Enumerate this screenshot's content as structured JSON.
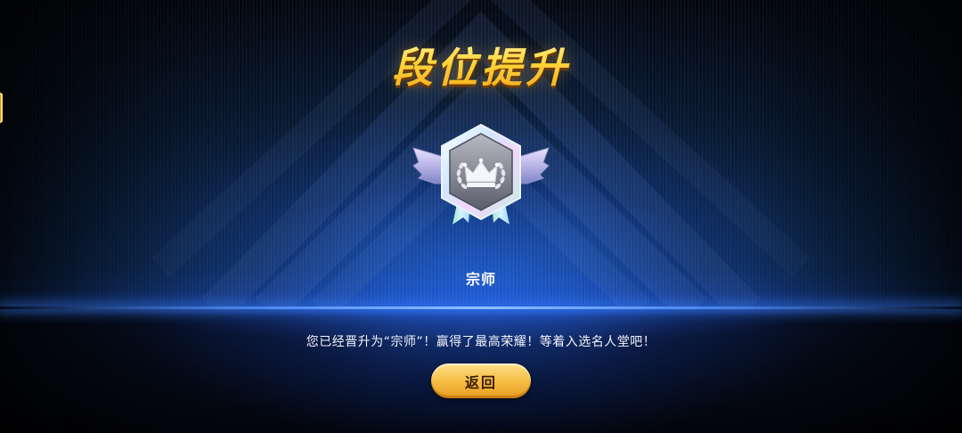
{
  "title": "段位提升",
  "rank": {
    "name": "宗师",
    "icon": "grandmaster-crown-badge-icon"
  },
  "message": "您已经晋升为“宗师”！赢得了最高荣耀！等着入选名人堂吧！",
  "back_button": {
    "label": "返回"
  },
  "side_badge": {
    "icon": "gold-hexagon-badge-icon"
  },
  "colors": {
    "title_gold": "#ffd23c",
    "button_gold": "#f7be47",
    "stage_blue": "#1b4fb8"
  }
}
